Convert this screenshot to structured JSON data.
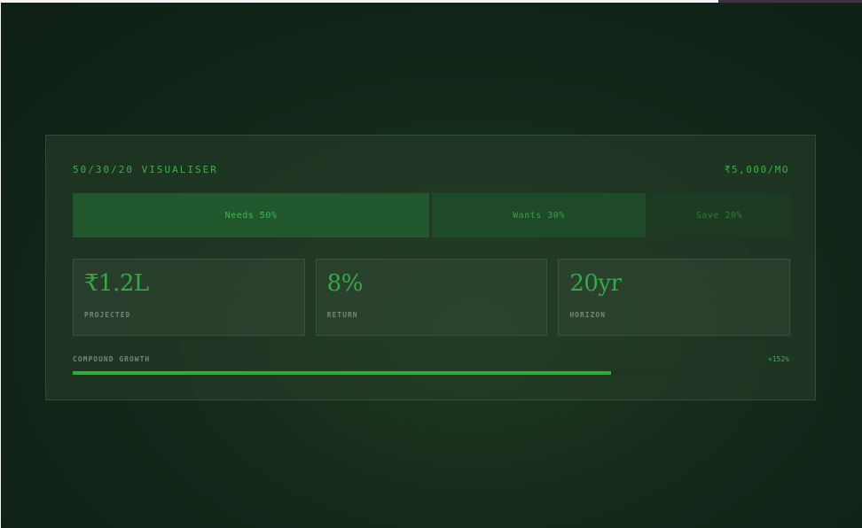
{
  "visualiser": {
    "title": "50/30/20 VISUALISER",
    "monthly_amount": "₹5,000/MO"
  },
  "allocation": {
    "segments": [
      {
        "label": "Needs 50%",
        "percent": 50,
        "color": "#22582e"
      },
      {
        "label": "Wants 30%",
        "percent": 30,
        "color": "#1f4a29"
      },
      {
        "label": "Save 20%",
        "percent": 20,
        "color": "#1d3b23"
      }
    ]
  },
  "stats": [
    {
      "value": "₹1.2L",
      "label": "PROJECTED"
    },
    {
      "value": "8%",
      "label": "RETURN"
    },
    {
      "value": "20yr",
      "label": "HORIZON"
    }
  ],
  "growth": {
    "label": "COMPOUND GROWTH",
    "value": "+152%",
    "progress_fraction": 0.75
  },
  "colors": {
    "accent": "#3fae4a",
    "background": "#14291a"
  }
}
